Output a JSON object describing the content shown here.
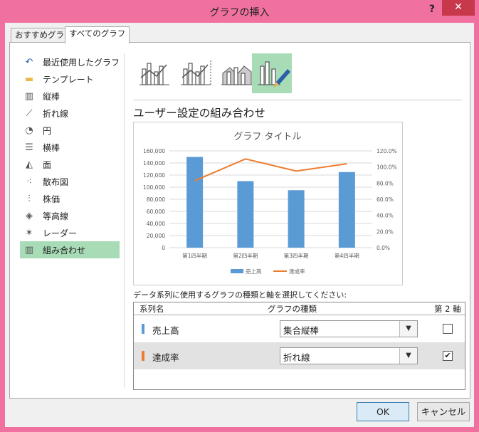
{
  "window": {
    "title": "グラフの挿入",
    "help": "?",
    "close": "✕"
  },
  "tabs": [
    {
      "label": "おすすめグラフ"
    },
    {
      "label": "すべてのグラフ"
    }
  ],
  "nav": [
    {
      "label": "最近使用したグラフ",
      "icon": "recent-icon",
      "glyph": "↶"
    },
    {
      "label": "テンプレート",
      "icon": "folder-icon",
      "glyph": "▬"
    },
    {
      "label": "縦棒",
      "icon": "column-chart-icon",
      "glyph": "▥"
    },
    {
      "label": "折れ線",
      "icon": "line-chart-icon",
      "glyph": "⟋"
    },
    {
      "label": "円",
      "icon": "pie-chart-icon",
      "glyph": "◔"
    },
    {
      "label": "横棒",
      "icon": "bar-chart-icon",
      "glyph": "☰"
    },
    {
      "label": "面",
      "icon": "area-chart-icon",
      "glyph": "◭"
    },
    {
      "label": "散布図",
      "icon": "scatter-chart-icon",
      "glyph": "⁖"
    },
    {
      "label": "株価",
      "icon": "stock-chart-icon",
      "glyph": "⫶"
    },
    {
      "label": "等高線",
      "icon": "surface-chart-icon",
      "glyph": "◈"
    },
    {
      "label": "レーダー",
      "icon": "radar-chart-icon",
      "glyph": "✶"
    },
    {
      "label": "組み合わせ",
      "icon": "combo-chart-icon",
      "glyph": "▥"
    }
  ],
  "section_heading": "ユーザー設定の組み合わせ",
  "chart_data": {
    "type": "bar",
    "title": "グラフ タイトル",
    "categories": [
      "第1四半期",
      "第2四半期",
      "第3四半期",
      "第4四半期"
    ],
    "series": [
      {
        "name": "売上高",
        "kind": "bar",
        "axis": "primary",
        "color": "#5b9bd5",
        "values": [
          150000,
          110000,
          95000,
          125000
        ]
      },
      {
        "name": "達成率",
        "kind": "line",
        "axis": "secondary",
        "color": "#ed7d31",
        "values": [
          0.83,
          1.1,
          0.95,
          1.04
        ]
      }
    ],
    "ylim": [
      0,
      160000
    ],
    "yticks": [
      "0",
      "20,000",
      "40,000",
      "60,000",
      "80,000",
      "100,000",
      "120,000",
      "140,000",
      "160,000"
    ],
    "y2lim": [
      0,
      1.2
    ],
    "y2ticks": [
      "0.0%",
      "20.0%",
      "40.0%",
      "60.0%",
      "80.0%",
      "100.0%",
      "120.0%"
    ],
    "legend_position": "bottom",
    "grid": true
  },
  "instruction": "データ系列に使用するグラフの種類と軸を選択してください:",
  "grid": {
    "headers": {
      "series": "系列名",
      "type": "グラフの種類",
      "axis": "第 2 軸"
    },
    "rows": [
      {
        "name": "売上高",
        "color": "#5b9bd5",
        "type": "集合縦棒",
        "secondary": false,
        "checkmark": ""
      },
      {
        "name": "達成率",
        "color": "#ed7d31",
        "type": "折れ線",
        "secondary": true,
        "checkmark": "✔"
      }
    ]
  },
  "buttons": {
    "ok": "OK",
    "cancel": "キャンセル"
  }
}
